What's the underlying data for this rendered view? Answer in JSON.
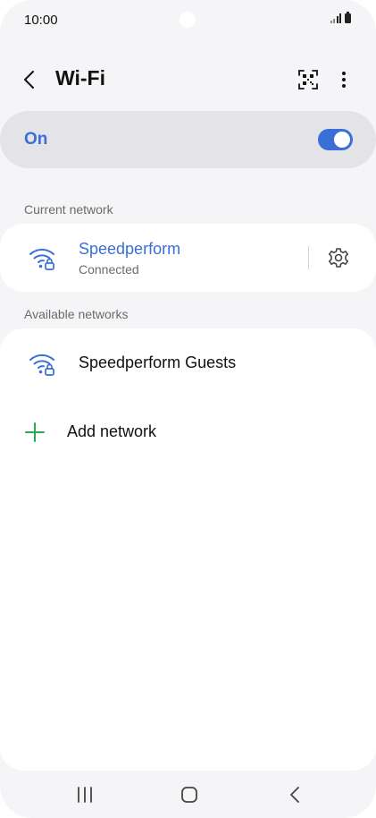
{
  "status_bar": {
    "time": "10:00"
  },
  "header": {
    "title": "Wi-Fi"
  },
  "wifi_toggle": {
    "label": "On",
    "enabled": true
  },
  "current_network": {
    "section_label": "Current network",
    "name": "Speedperform",
    "status": "Connected"
  },
  "available_networks": {
    "section_label": "Available networks",
    "items": [
      {
        "name": "Speedperform Guests"
      }
    ]
  },
  "add_network": {
    "label": "Add network"
  },
  "colors": {
    "accent": "#3a6fd8",
    "add_icon": "#2ea84d",
    "background": "#f5f5f7",
    "card": "#ffffff",
    "toggle_card": "#e4e4e8"
  },
  "icons": {
    "back": "chevron-left-icon",
    "qr": "qr-code-scan-icon",
    "more": "more-vertical-icon",
    "wifi": "wifi-lock-icon",
    "settings": "gear-icon",
    "add": "plus-icon",
    "recents": "recents-icon",
    "home": "home-icon",
    "nav_back": "chevron-left-icon"
  }
}
